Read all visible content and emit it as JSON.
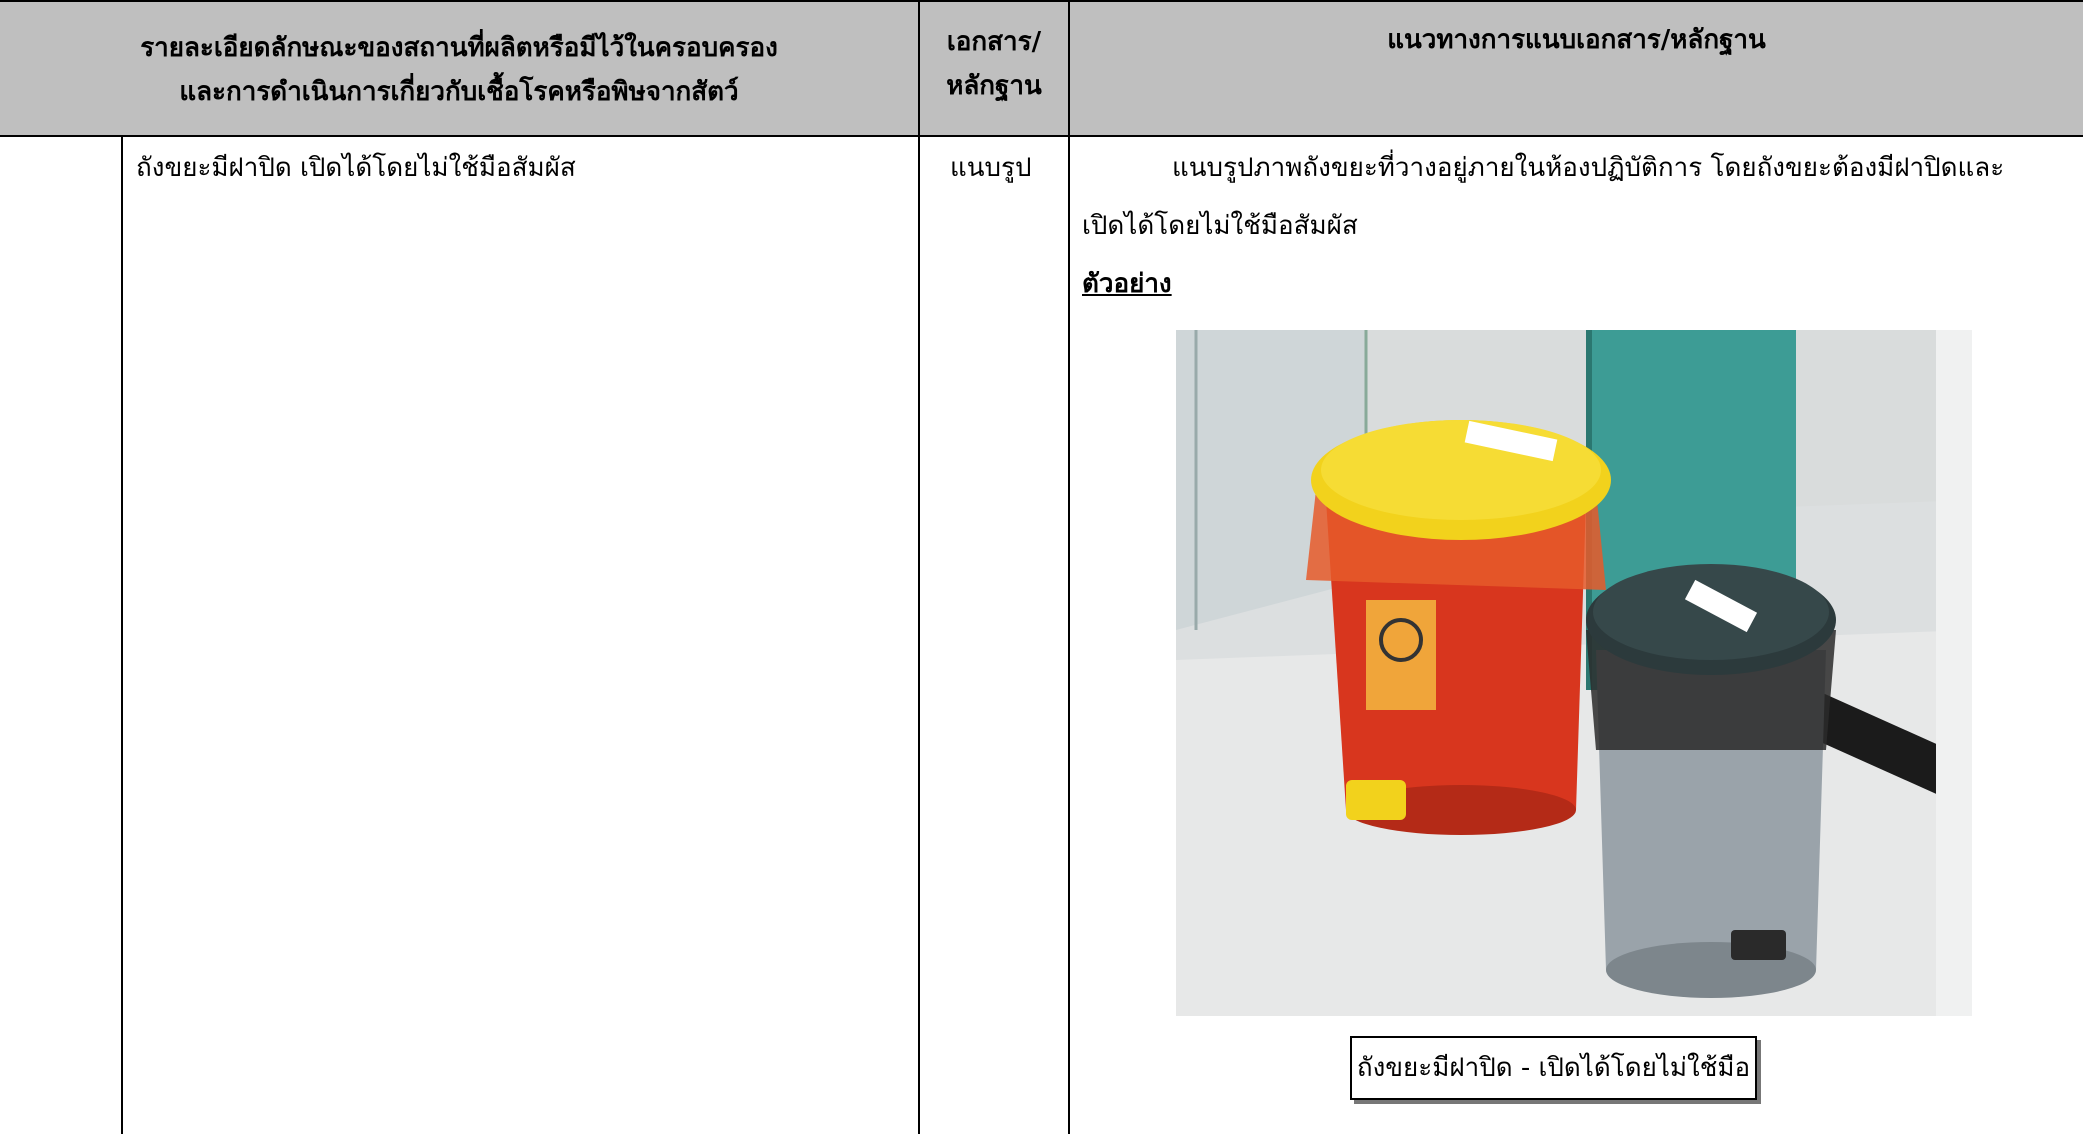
{
  "header": {
    "col1_line1": "รายละเอียดลักษณะของสถานที่ผลิตหรือมีไว้ในครอบครอง",
    "col1_line2": "และการดำเนินการเกี่ยวกับเชื้อโรคหรือพิษจากสัตว์",
    "col2_line1": "เอกสาร/",
    "col2_line2": "หลักฐาน",
    "col3": "แนวทางการแนบเอกสาร/หลักฐาน"
  },
  "row": {
    "detail": "ถังขยะมีฝาปิด เปิดได้โดยไม่ใช้มือสัมผัส",
    "document": "แนบรูป",
    "guide_line1": "แนบรูปภาพถังขยะที่วางอยู่ภายในห้องปฏิบัติการ โดยถังขยะต้องมีฝาปิดและ",
    "guide_line2": "เปิดได้โดยไม่ใช้มือสัมผัส",
    "example_label": "ตัวอย่าง",
    "caption": "ถังขยะมีฝาปิด - เปิดได้โดยไม่ใช้มือ"
  },
  "colors": {
    "header_bg": "#bfbfbf",
    "red_bin": "#d8361e",
    "yellow_lid": "#f2d21c",
    "grey_bin": "#9aa3aa",
    "dark_lid": "#2c3a3c",
    "teal_panel": "#3d9c95"
  }
}
